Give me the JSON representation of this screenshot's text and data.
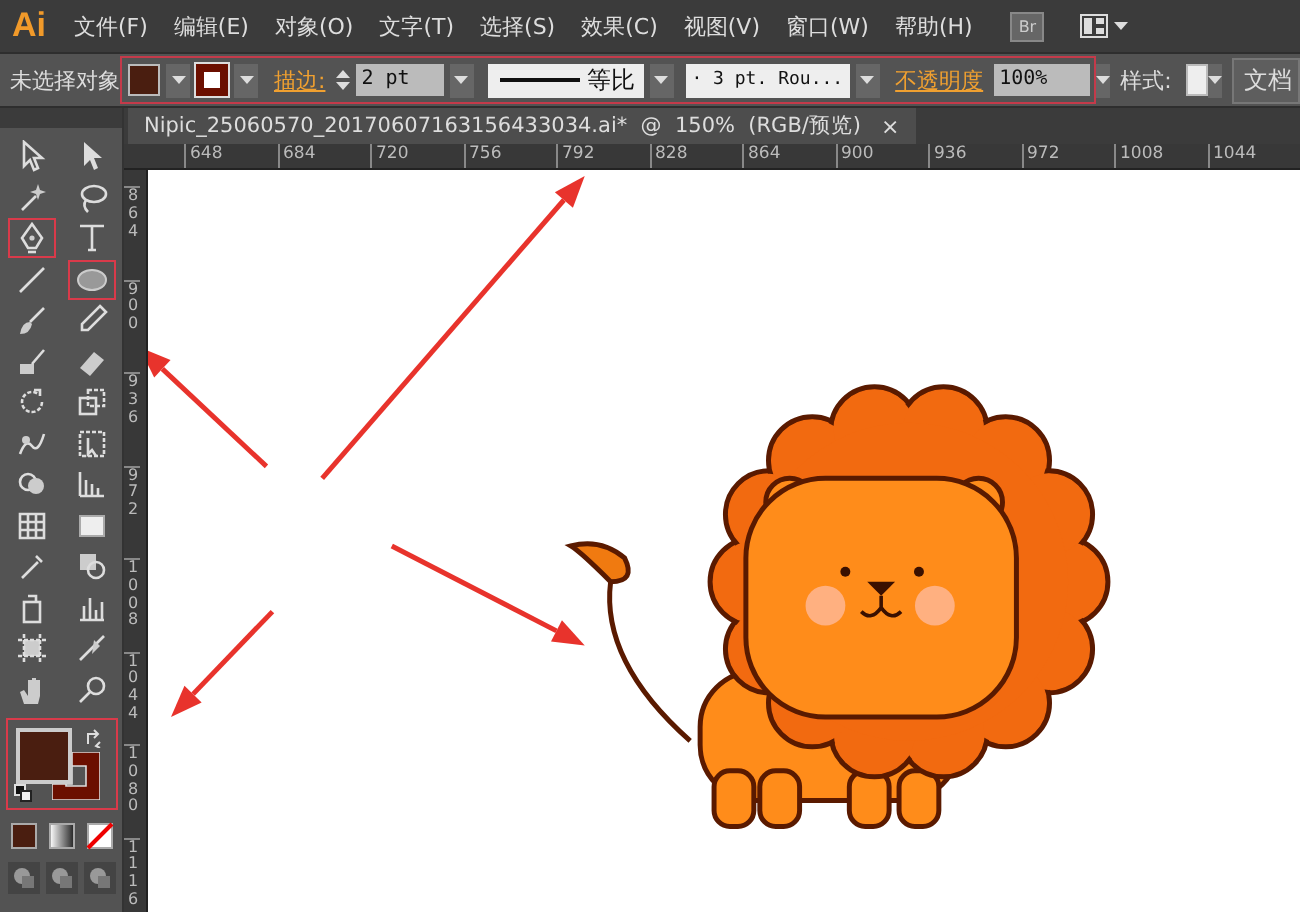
{
  "app": {
    "logo": "Ai"
  },
  "menu": [
    "文件(F)",
    "编辑(E)",
    "对象(O)",
    "文字(T)",
    "选择(S)",
    "效果(C)",
    "视图(V)",
    "窗口(W)",
    "帮助(H)"
  ],
  "bridge_button": "Br",
  "control_bar": {
    "selection_label": "未选择对象",
    "highlighted": true,
    "fill": {
      "color": "#4a1e10"
    },
    "stroke": {
      "color": "#6b0f00"
    },
    "stroke_link": "描边:",
    "stroke_weight": "2 pt",
    "profile": "等比",
    "brush": "· 3 pt. Rou...",
    "opacity_link": "不透明度",
    "opacity": "100%",
    "style_label": "样式:",
    "document_button": "文档"
  },
  "document_tab": {
    "title": "Nipic_25060570_20170607163156433034.ai*  @  150%  (RGB/预览)",
    "close": "×"
  },
  "ruler_h": [
    "648",
    "684",
    "720",
    "756",
    "792",
    "828",
    "864",
    "900",
    "936",
    "972",
    "1008",
    "1044"
  ],
  "ruler_v": [
    "864",
    "900",
    "936",
    "972",
    "1008",
    "1044",
    "1080",
    "1116"
  ],
  "tools": [
    {
      "kind": "selection",
      "highlighted": false
    },
    {
      "kind": "direct",
      "highlighted": false
    },
    {
      "kind": "wand",
      "highlighted": false
    },
    {
      "kind": "lasso",
      "highlighted": false
    },
    {
      "kind": "pen",
      "highlighted": true
    },
    {
      "kind": "type",
      "highlighted": false
    },
    {
      "kind": "line",
      "highlighted": false
    },
    {
      "kind": "ellipse",
      "highlighted": true
    },
    {
      "kind": "brush",
      "highlighted": false
    },
    {
      "kind": "pencil",
      "highlighted": false
    },
    {
      "kind": "blob",
      "highlighted": false
    },
    {
      "kind": "eraser",
      "highlighted": false
    },
    {
      "kind": "rotate",
      "highlighted": false
    },
    {
      "kind": "scale",
      "highlighted": false
    },
    {
      "kind": "warp",
      "highlighted": false
    },
    {
      "kind": "transform",
      "highlighted": false
    },
    {
      "kind": "builder",
      "highlighted": false
    },
    {
      "kind": "perspective",
      "highlighted": false
    },
    {
      "kind": "mesh",
      "highlighted": false
    },
    {
      "kind": "gradient",
      "highlighted": false
    },
    {
      "kind": "eyedropper",
      "highlighted": false
    },
    {
      "kind": "blend",
      "highlighted": false
    },
    {
      "kind": "sprayer",
      "highlighted": false
    },
    {
      "kind": "graph",
      "highlighted": false
    },
    {
      "kind": "artboard",
      "highlighted": false
    },
    {
      "kind": "slice",
      "highlighted": false
    },
    {
      "kind": "hand",
      "highlighted": false
    },
    {
      "kind": "zoom",
      "highlighted": false
    }
  ],
  "fill_stroke": {
    "highlighted": true,
    "fill": {
      "color": "#4a1e10"
    },
    "stroke": {
      "color": "#6b0f00"
    }
  }
}
